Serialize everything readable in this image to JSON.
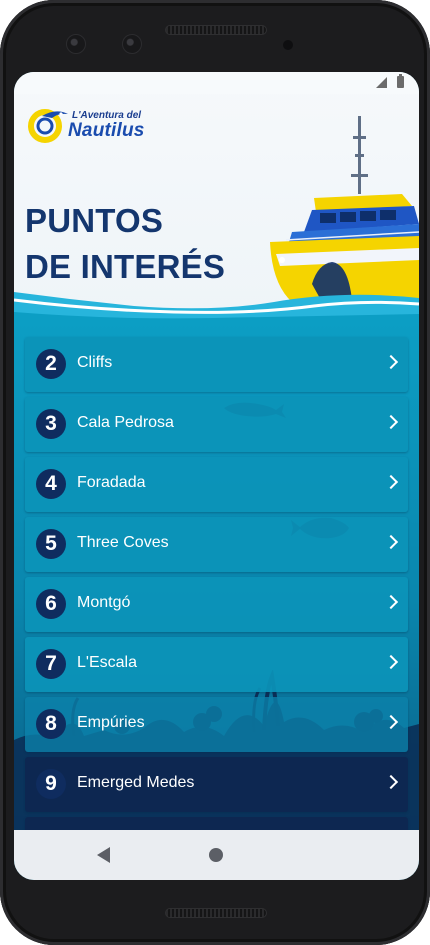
{
  "app": {
    "logo_top": "L'Aventura del",
    "logo_main": "Nautilus"
  },
  "header": {
    "title_line1": "PUNTOS",
    "title_line2": "DE INTERÉS"
  },
  "points": [
    {
      "number": "2",
      "label": "Cliffs"
    },
    {
      "number": "3",
      "label": "Cala Pedrosa"
    },
    {
      "number": "4",
      "label": "Foradada"
    },
    {
      "number": "5",
      "label": "Three Coves"
    },
    {
      "number": "6",
      "label": "Montgó"
    },
    {
      "number": "7",
      "label": "L'Escala"
    },
    {
      "number": "8",
      "label": "Empúries"
    },
    {
      "number": "9",
      "label": "Emerged Medes"
    }
  ],
  "icons": {
    "item_arrow": "chevron-right-icon",
    "nav_back": "back-icon",
    "nav_home": "home-icon"
  },
  "colors": {
    "title": "#14366e",
    "list_bg": "#0c9ec4",
    "badge": "#0f2c5f",
    "boat_yellow": "#f5d400"
  }
}
